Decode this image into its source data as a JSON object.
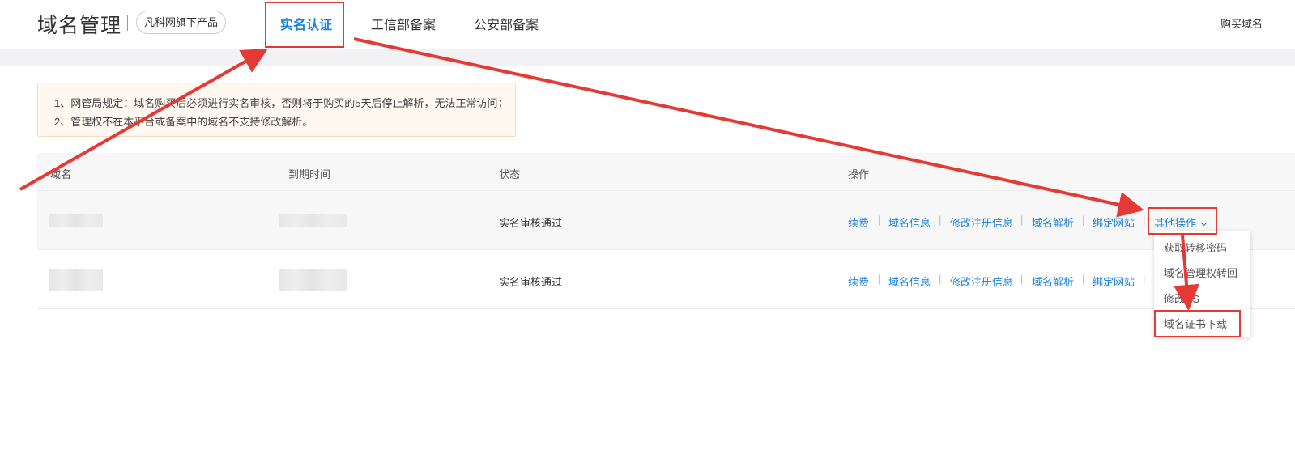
{
  "header": {
    "brand": "域名管理",
    "badge": "凡科网旗下产品",
    "tabs": [
      {
        "label": "实名认证",
        "active": true
      },
      {
        "label": "工信部备案",
        "active": false
      },
      {
        "label": "公安部备案",
        "active": false
      }
    ],
    "buy_link": "购买域名"
  },
  "notice": {
    "lines": [
      "1、网管局规定：域名购买后必须进行实名审核，否则将于购买的5天后停止解析，无法正常访问；",
      "2、管理权不在本平台或备案中的域名不支持修改解析。"
    ]
  },
  "table": {
    "columns": [
      "域名",
      "到期时间",
      "状态",
      "操作"
    ],
    "rows": [
      {
        "domain_blurred": true,
        "expiry_blurred": true,
        "status": "实名审核通过",
        "actions": [
          "续费",
          "域名信息",
          "修改注册信息",
          "域名解析",
          "绑定网站"
        ],
        "more_label": "其他操作",
        "more_chevron": "chevron-down-icon"
      },
      {
        "domain_blurred": true,
        "expiry_blurred": true,
        "status": "实名审核通过",
        "actions": [
          "续费",
          "域名信息",
          "修改注册信息",
          "域名解析",
          "绑定网站"
        ]
      }
    ]
  },
  "dropdown": {
    "items": [
      "获取转移密码",
      "域名管理权转回",
      "修改NS",
      "域名证书下载"
    ]
  },
  "colors": {
    "accent": "#1a82e2",
    "annotation": "#e53935",
    "notice_bg": "#fff8f0"
  }
}
